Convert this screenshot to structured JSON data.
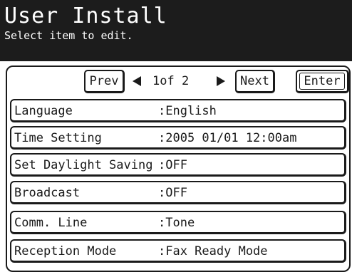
{
  "header": {
    "title": "User Install",
    "subtitle": "Select item to edit."
  },
  "nav": {
    "prev_label": "Prev",
    "page_indicator": "1of  2",
    "next_label": "Next",
    "enter_label": "Enter"
  },
  "items": [
    {
      "label": "Language",
      "value": ":English"
    },
    {
      "label": "Time Setting",
      "value": ":2005 01/01 12:00am"
    },
    {
      "label": "Set Daylight Saving",
      "value": ":OFF"
    },
    {
      "label": "Broadcast",
      "value": ":OFF"
    },
    {
      "label": "Comm. Line",
      "value": ":Tone"
    },
    {
      "label": "Reception Mode",
      "value": ":Fax Ready Mode"
    }
  ],
  "colors": {
    "header_bg": "#1c1c1c",
    "header_fg": "#ffffff",
    "ink": "#1a1a1a"
  },
  "icons": {
    "prev_arrow": "left-triangle-icon",
    "next_arrow": "right-triangle-icon"
  }
}
